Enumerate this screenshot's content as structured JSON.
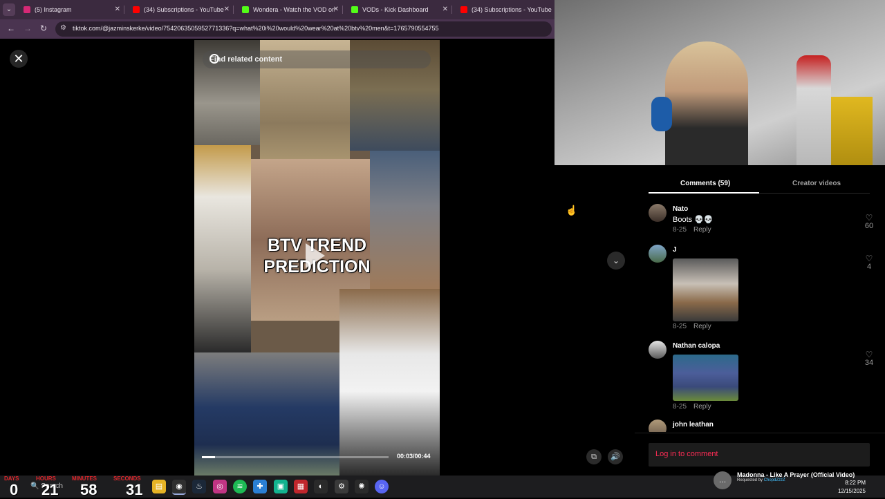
{
  "browser": {
    "tabs": [
      {
        "title": "(5) Instagram",
        "favicon_color": "#d62976"
      },
      {
        "title": "(34) Subscriptions - YouTube",
        "favicon_color": "#ff0000"
      },
      {
        "title": "Wondera - Watch the VOD on",
        "favicon_color": "#53fc18"
      },
      {
        "title": "VODs - Kick Dashboard",
        "favicon_color": "#53fc18"
      },
      {
        "title": "(34) Subscriptions - YouTube",
        "favicon_color": "#ff0000"
      }
    ],
    "url": "tiktok.com/@jazminskerke/video/7542063505952771336?q=what%20i%20would%20wear%20at%20btv%20men&t=1765790554755"
  },
  "video": {
    "search_placeholder": "Find related content",
    "overlay_line1": "BTV TREND",
    "overlay_line2": "PREDICTION",
    "time": "00:03/00:44",
    "progress": 0.07
  },
  "comments_panel": {
    "tab_comments": "Comments (59)",
    "tab_creator": "Creator videos",
    "comments": [
      {
        "name": "Nato",
        "text": "Boots 💀💀",
        "date": "8-25",
        "reply": "Reply",
        "likes": "60"
      },
      {
        "name": "J",
        "text": "",
        "date": "8-25",
        "reply": "Reply",
        "likes": "4"
      },
      {
        "name": "Nathan calopa",
        "text": "",
        "date": "8-25",
        "reply": "Reply",
        "likes": "34"
      },
      {
        "name": "john leathan",
        "text": "",
        "date": "",
        "reply": "",
        "likes": ""
      }
    ],
    "login_label": "Log in to comment"
  },
  "countdown": {
    "labels": [
      "DAYS",
      "HOURS",
      "MINUTES",
      "SECONDS"
    ],
    "values": [
      "0",
      "21",
      "58",
      "31"
    ]
  },
  "taskbar": {
    "search_label": "Search",
    "now_playing": "Madonna - Like A Prayer (Official Video)",
    "requested_by_prefix": "Requested by",
    "requested_by_user": "ChopdZzzZ",
    "time": "8:22 PM",
    "date": "12/15/2025"
  }
}
